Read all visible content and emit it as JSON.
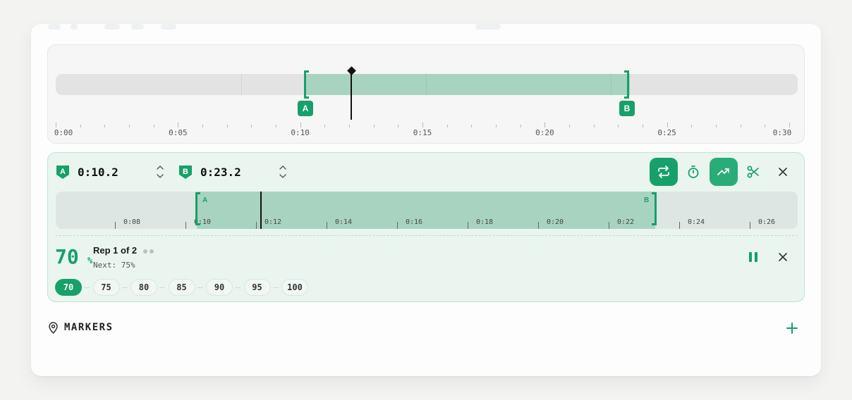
{
  "timeline": {
    "tick_labels": [
      "0:00",
      "0:05",
      "0:10",
      "0:15",
      "0:20",
      "0:25",
      "0:30"
    ],
    "duration_seconds": 30,
    "playhead_seconds": 12,
    "marker_a_label": "A",
    "marker_b_label": "B"
  },
  "loop": {
    "a_badge": "A",
    "a_time": "0:10.2",
    "b_badge": "B",
    "b_time": "0:23.2",
    "tools": {
      "loop_icon": "repeat-icon",
      "timer_icon": "stopwatch-icon",
      "trend_icon": "trending-up-icon",
      "cut_icon": "scissors-icon",
      "close_icon": "close-icon"
    },
    "zoom": {
      "tick_labels": [
        "0:08",
        "0:10",
        "0:12",
        "0:14",
        "0:16",
        "0:18",
        "0:20",
        "0:22",
        "0:24",
        "0:26"
      ],
      "a_label": "A",
      "b_label": "B"
    },
    "practice": {
      "percent": "70",
      "percent_unit": "%",
      "rep_text": "Rep 1 of 2",
      "next_text": "Next: 75%",
      "speeds": [
        "70",
        "75",
        "80",
        "85",
        "90",
        "95",
        "100"
      ],
      "active_speed": "70"
    }
  },
  "markers": {
    "title": "MARKERS",
    "pin_icon": "map-pin-icon",
    "add_icon": "plus-icon"
  },
  "colors": {
    "accent": "#17a06a",
    "selection": "#a9d3c1",
    "panel_bg": "#eaf5f0"
  }
}
